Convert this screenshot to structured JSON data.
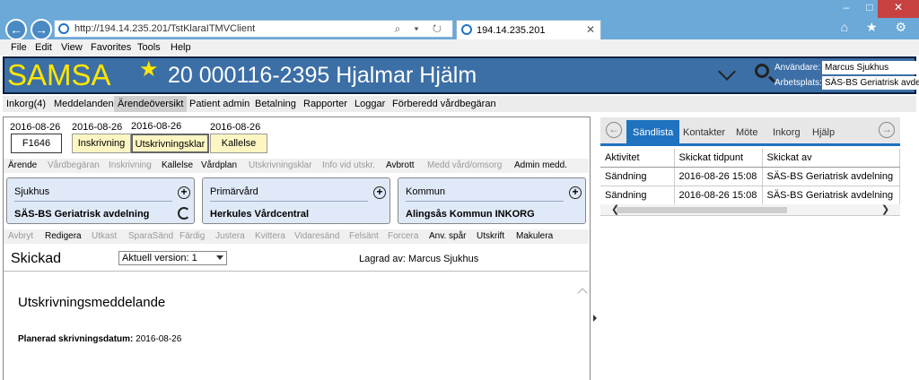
{
  "browser": {
    "url": "http://194.14.235.201/TstKlaraITMVClient",
    "tab_title": "194.14.235.201",
    "url_icons": "⌕ ▾ ↻",
    "win_min": "‒",
    "win_max": "□",
    "win_close": "✕",
    "toolbar_icons": "⌂ ★ ⚙"
  },
  "menu": [
    "File",
    "Edit",
    "View",
    "Favorites",
    "Tools",
    "Help"
  ],
  "header": {
    "logo": "SAMSA",
    "patient": "20 000116-2395 Hjalmar Hjälm",
    "user_label": "Användare:",
    "user_value": "Marcus Sjukhus",
    "workplace_label": "Arbetsplats:",
    "workplace_value": "SÄS-BS Geriatrisk avdelning"
  },
  "nav_tabs": [
    "Inkorg(4)",
    "Meddelanden",
    "Ärendeöversikt",
    "Patient admin",
    "Betalning",
    "Rapporter",
    "Loggar",
    "Förberedd vårdbegäran"
  ],
  "nav_selected": "Ärendeöversikt",
  "steps": [
    {
      "date": "2016-08-26",
      "label": "F1646"
    },
    {
      "date": "2016-08-26",
      "label": "Inskrivning"
    },
    {
      "date": "2016-08-26",
      "label": "Utskrivningsklar"
    },
    {
      "date": "2016-08-26",
      "label": "Kallelse"
    }
  ],
  "actions1": {
    "arende": "Ärende",
    "vardbegaran": "Vårdbegäran",
    "inskrivning": "Inskrivning",
    "kallelse": "Kallelse",
    "vardplan": "Vårdplan",
    "utskrivningsklar": "Utskrivningsklar",
    "info": "Info vid utskr.",
    "avbrott": "Avbrott",
    "medd": "Medd vård/omsorg",
    "admin": "Admin medd."
  },
  "cards": [
    {
      "title": "Sjukhus",
      "value": "SÄS-BS Geriatrisk avdelning"
    },
    {
      "title": "Primärvård",
      "value": "Herkules Vårdcentral"
    },
    {
      "title": "Kommun",
      "value": "Alingsås Kommun INKORG"
    }
  ],
  "card_plus": "+",
  "actions2": {
    "avbryt": "Avbryt",
    "redigera": "Redigera",
    "utkast": "Utkast",
    "sparasand": "SparaSänd",
    "fardig": "Färdig",
    "justera": "Justera",
    "kvittera": "Kvittera",
    "vidaresand": "Vidaresänd",
    "felsant": "Felsänt",
    "forcera": "Forcera",
    "anvspar": "Anv. spår",
    "utskrift": "Utskrift",
    "makulera": "Makulera"
  },
  "document": {
    "status": "Skickad",
    "version": "Aktuell version: 1",
    "saved_by": "Lagrad av: Marcus Sjukhus",
    "title": "Utskrivningsmeddelande",
    "planned_label": "Planerad skrivningsdatum:",
    "planned_value": "2016-08-26"
  },
  "right": {
    "tabs": [
      "Sändlista",
      "Kontakter",
      "Möte",
      "Inkorg",
      "Hjälp"
    ],
    "prev": "←",
    "next": "→",
    "columns": [
      "Aktivitet",
      "Skickat tidpunt",
      "Skickat av"
    ],
    "rows": [
      [
        "Sändning",
        "2016-08-26 15:08",
        "SÄS-BS Geriatrisk avdelning"
      ],
      [
        "Sändning",
        "2016-08-26 15:08",
        "SÄS-BS Geriatrisk avdelning"
      ]
    ],
    "scroll_left": "❮",
    "scroll_right": "❯"
  },
  "colors": {
    "header_blue": "#3c6fa6",
    "logo_yellow": "#ffe600",
    "tab_blue": "#1e72bf",
    "step_yellow": "#fdf6c3",
    "card_blue": "#dfe9f7"
  }
}
